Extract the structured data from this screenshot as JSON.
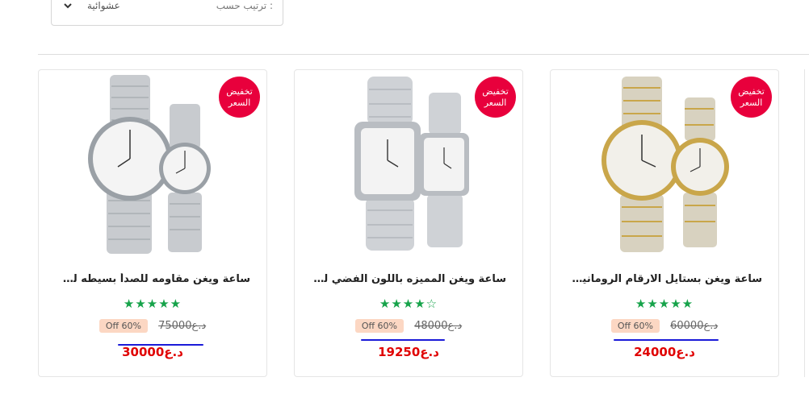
{
  "sort": {
    "label": "ترتيب حسب :",
    "value": "عشوائية"
  },
  "products": [
    {
      "badge": "تخفيض السعر",
      "title": "ساعة ويغن مقاومه للصدأ بسيطه للأزواج",
      "rating": 5,
      "discount": "Off 60%",
      "old_price": "75000د.ع",
      "new_price": "30000د.ع"
    },
    {
      "badge": "تخفيض السعر",
      "title": "ساعة ويغن المميزه باللون الفضي للأزواج",
      "rating": 4,
      "discount": "Off 60%",
      "old_price": "48000د.ع",
      "new_price": "19250د.ع"
    },
    {
      "badge": "تخفيض السعر",
      "title": "ساعة ويغن بستايل الارقام الرومانيه للأزواج",
      "rating": 5,
      "discount": "Off 60%",
      "old_price": "60000د.ع",
      "new_price": "24000د.ع"
    }
  ],
  "colors": {
    "badge": "#e8003c",
    "price": "#e00000",
    "stars": "#16a34a",
    "off_bg": "#fcd7c3",
    "ink": "#1a1ad8"
  }
}
